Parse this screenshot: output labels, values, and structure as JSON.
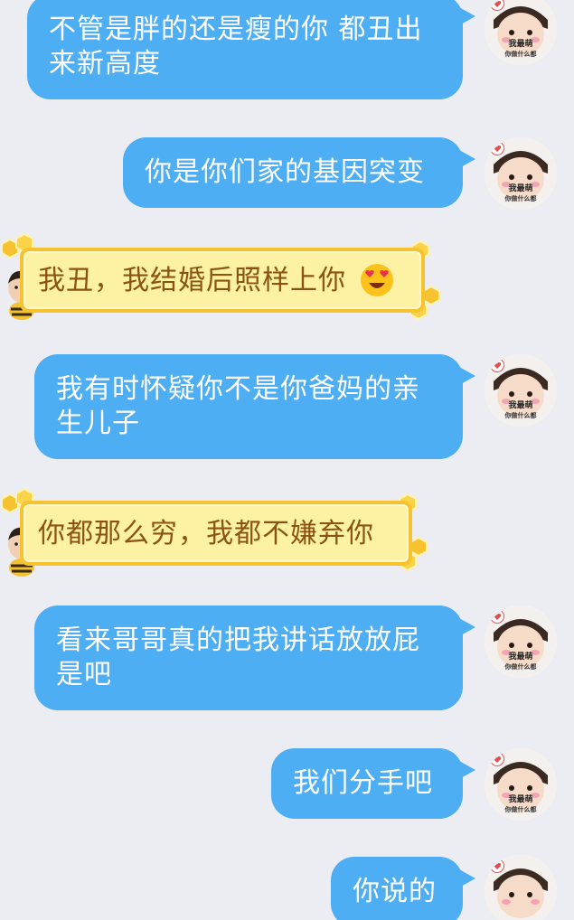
{
  "conversation": {
    "messages": [
      {
        "side": "out",
        "text": "不管是胖的还是瘦的你 都丑出来新高度"
      },
      {
        "side": "out",
        "text": "你是你们家的基因突变"
      },
      {
        "side": "in",
        "text": "我丑，我结婚后照样上你",
        "emoji": "heart-eyes-emoji"
      },
      {
        "side": "out",
        "text": "我有时怀疑你不是你爸妈的亲生儿子"
      },
      {
        "side": "in",
        "text": "你都那么穷，我都不嫌弃你"
      },
      {
        "side": "out",
        "text": "看来哥哥真的把我讲话放放屁是吧"
      },
      {
        "side": "out",
        "text": "我们分手吧"
      },
      {
        "side": "out",
        "text": "你说的"
      }
    ]
  },
  "my_avatar": {
    "caption_line1": "我最萌",
    "caption_line2": "你做什么都"
  },
  "colors": {
    "background": "#ebedf3",
    "outgoing_bubble": "#4eaef3",
    "incoming_bubble_fill": "#fdf1a3",
    "incoming_bubble_border": "#f6c230",
    "incoming_text": "#8a5410"
  },
  "icons": {
    "my_avatar": "baby-avatar",
    "partner_avatar": "man-bee-avatar",
    "emoji": "heart-eyes-emoji",
    "bubble_frame": "honeycomb"
  }
}
